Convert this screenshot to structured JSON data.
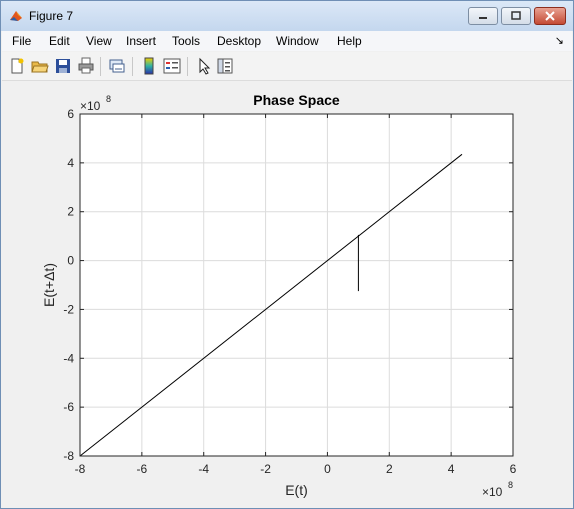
{
  "window": {
    "title": "Figure 7",
    "icons": {
      "app": "matlab-icon",
      "minimize": "minimize-icon",
      "maximize": "maximize-icon",
      "close": "close-icon"
    }
  },
  "menu": {
    "items": [
      "File",
      "Edit",
      "View",
      "Insert",
      "Tools",
      "Desktop",
      "Window",
      "Help"
    ],
    "dock_arrow": "↘"
  },
  "toolbar": {
    "icons": [
      "new-figure-icon",
      "open-file-icon",
      "save-icon",
      "print-icon",
      "link-plot-icon",
      "colorbar-icon",
      "legend-icon",
      "edit-plot-arrow-icon",
      "property-editor-icon"
    ]
  },
  "chart_data": {
    "type": "line",
    "title": "Phase Space",
    "xlabel": "E(t)",
    "ylabel": "E(t+Δt)",
    "xlim": [
      -8,
      6
    ],
    "ylim": [
      -8,
      6
    ],
    "xticks": [
      -8,
      -6,
      -4,
      -2,
      0,
      2,
      4,
      6
    ],
    "yticks": [
      -8,
      -6,
      -4,
      -2,
      0,
      2,
      4,
      6
    ],
    "x_multiplier": "×10",
    "x_exponent": "8",
    "y_multiplier": "×10",
    "y_exponent": "8",
    "grid": true,
    "line_color": "#000000",
    "series": [
      {
        "x": [
          -8,
          4.35
        ],
        "y": [
          -8,
          4.35
        ]
      },
      {
        "x": [
          1.0,
          1.0
        ],
        "y": [
          1.05,
          -1.25
        ]
      }
    ]
  }
}
